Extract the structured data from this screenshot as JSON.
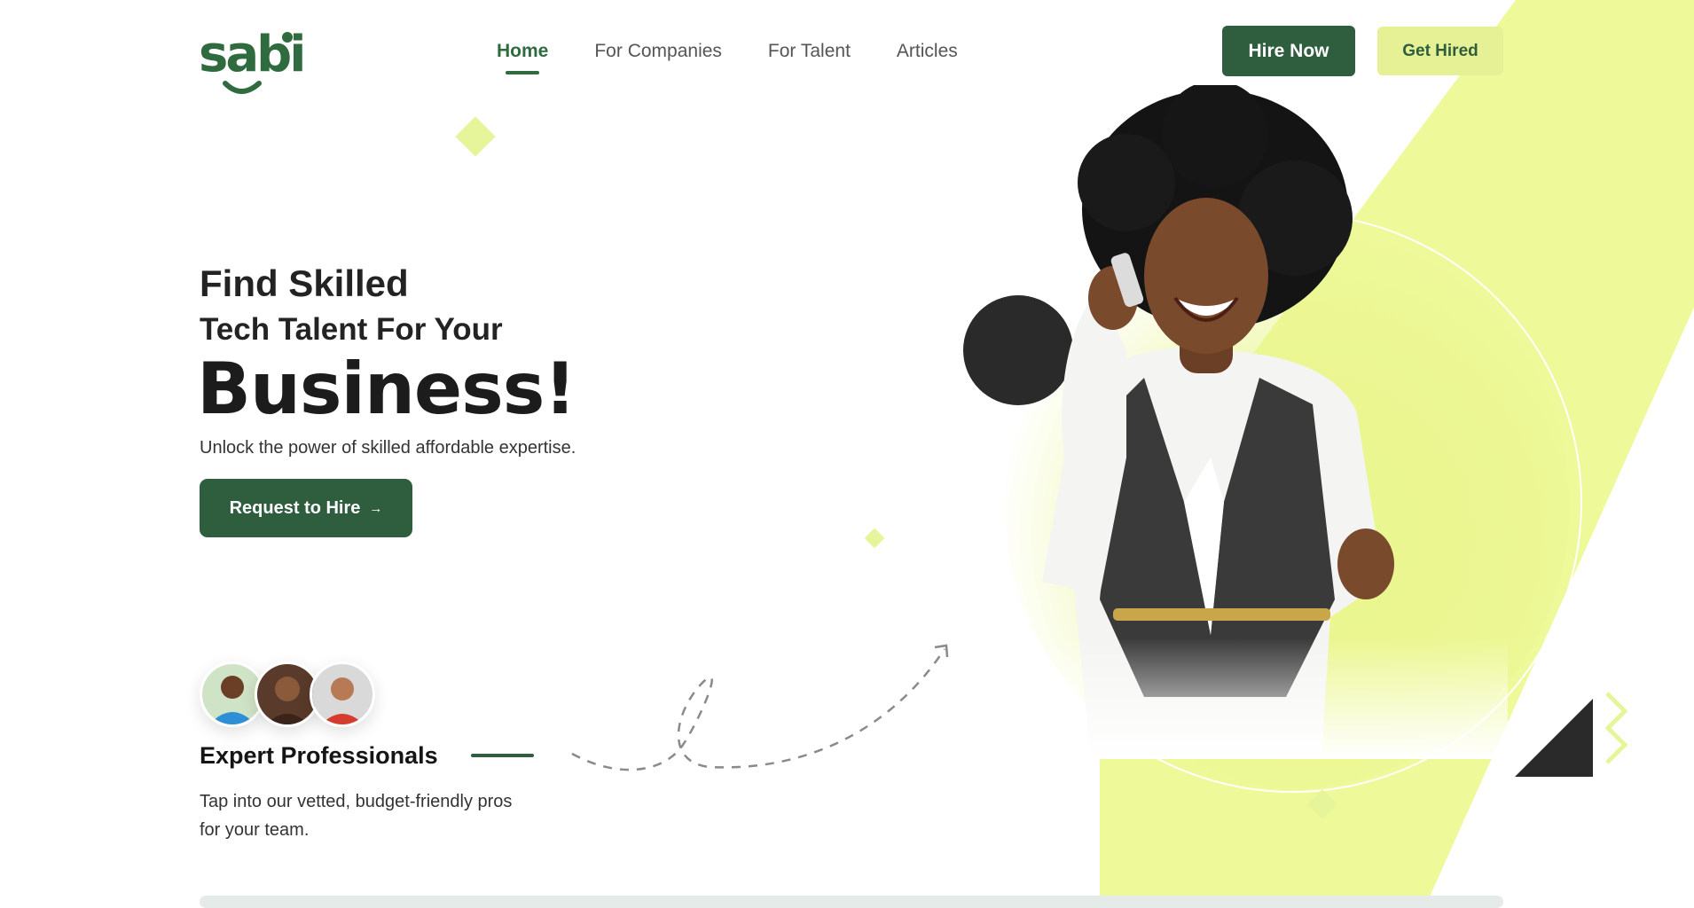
{
  "brand": {
    "logo_text": "sabi",
    "primary_color": "#2e5e3e",
    "accent_color": "#e6f196"
  },
  "nav": {
    "items": [
      {
        "label": "Home",
        "active": true
      },
      {
        "label": "For Companies",
        "active": false
      },
      {
        "label": "For Talent",
        "active": false
      },
      {
        "label": "Articles",
        "active": false
      }
    ]
  },
  "header": {
    "hire_now_label": "Hire Now",
    "get_hired_label": "Get Hired"
  },
  "hero": {
    "line1": "Find Skilled",
    "line2": "Tech Talent For Your",
    "line3": "Business!",
    "subtitle": "Unlock the power of skilled affordable expertise.",
    "cta_label": "Request to Hire",
    "cta_icon": "arrow-right-icon"
  },
  "experts": {
    "title": "Expert Professionals",
    "description": "Tap into our vetted, budget-friendly pros for your team."
  }
}
